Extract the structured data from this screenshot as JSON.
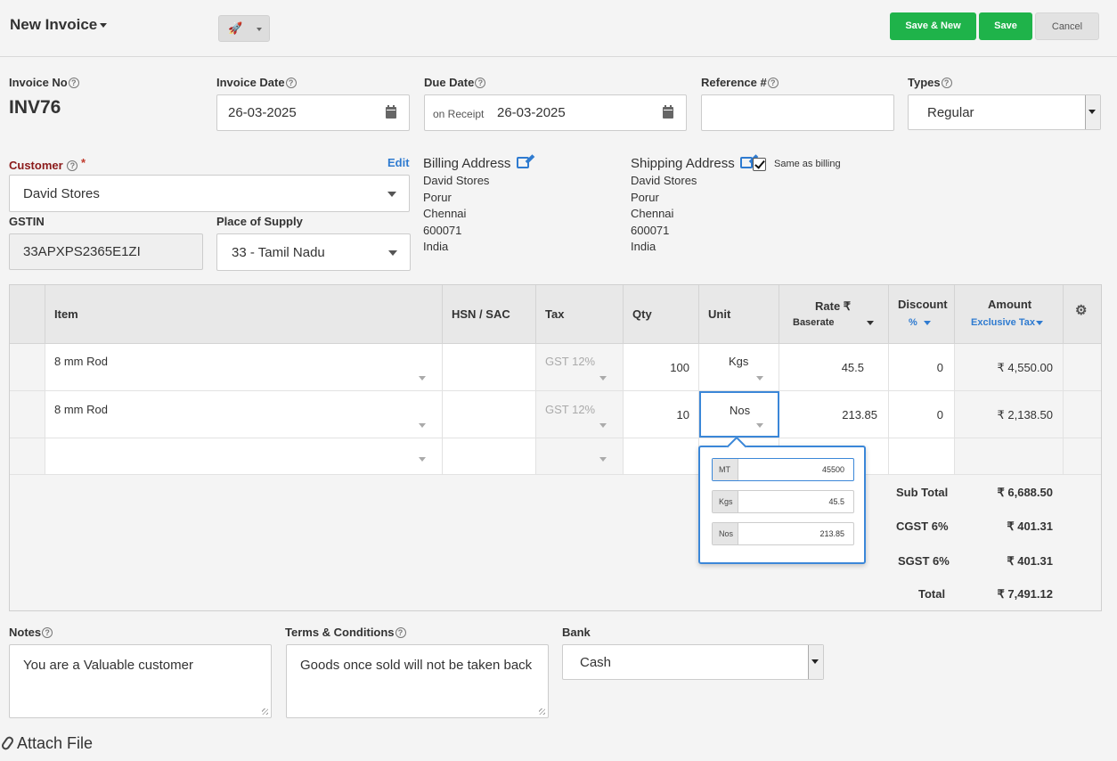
{
  "header": {
    "title": "New Invoice",
    "save_new_label": "Save & New",
    "save_label": "Save",
    "cancel_label": "Cancel"
  },
  "form": {
    "invoice_no_label": "Invoice No",
    "invoice_no": "INV76",
    "invoice_date_label": "Invoice Date",
    "invoice_date": "26-03-2025",
    "due_date_label": "Due Date",
    "due_date_prefix": "on Receipt",
    "due_date": "26-03-2025",
    "reference_label": "Reference #",
    "reference": "",
    "types_label": "Types",
    "types_value": "Regular",
    "customer_label": "Customer",
    "required_mark": "*",
    "edit_label": "Edit",
    "customer_value": "David Stores",
    "gstin_label": "GSTIN",
    "gstin_value": "33APXPS2365E1ZI",
    "place_label": "Place of Supply",
    "place_value": "33 - Tamil Nadu",
    "billing_title": "Billing Address",
    "billing_lines": [
      "David Stores",
      "Porur",
      "Chennai",
      "600071",
      "India"
    ],
    "shipping_title": "Shipping Address",
    "same_as_billing": "Same as billing",
    "shipping_lines": [
      "David Stores",
      "Porur",
      "Chennai",
      "600071",
      "India"
    ]
  },
  "table": {
    "headers": {
      "item": "Item",
      "hsn": "HSN / SAC",
      "tax": "Tax",
      "qty": "Qty",
      "unit": "Unit",
      "rate": "Rate ₹",
      "rate_sub": "Baserate",
      "discount": "Discount",
      "discount_sub": "%",
      "amount": "Amount",
      "amount_sub": "Exclusive Tax"
    },
    "rows": [
      {
        "item": "8 mm Rod",
        "tax": "GST 12%",
        "qty": "100",
        "unit": "Kgs",
        "rate": "45.5",
        "discount": "0",
        "amount": "₹ 4,550.00"
      },
      {
        "item": "8 mm Rod",
        "tax": "GST 12%",
        "qty": "10",
        "unit": "Nos",
        "rate": "213.85",
        "discount": "0",
        "amount": "₹ 2,138.50"
      }
    ],
    "totals": {
      "subtotal_label": "Sub Total",
      "subtotal": "₹ 6,688.50",
      "cgst_label": "CGST 6%",
      "cgst": "₹ 401.31",
      "sgst_label": "SGST 6%",
      "sgst": "₹ 401.31",
      "total_label": "Total",
      "total": "₹ 7,491.12"
    }
  },
  "unit_popup": {
    "rows": [
      {
        "unit": "MT",
        "value": "45500"
      },
      {
        "unit": "Kgs",
        "value": "45.5"
      },
      {
        "unit": "Nos",
        "value": "213.85"
      }
    ]
  },
  "footer": {
    "notes_label": "Notes",
    "notes_value": "You are a Valuable customer",
    "terms_label": "Terms & Conditions",
    "terms_value": "Goods once sold will not be taken back",
    "bank_label": "Bank",
    "bank_value": "Cash",
    "attach_label": "Attach File"
  },
  "colors": {
    "green": "#1fb34a",
    "accent_blue": "#2f7bd0",
    "customer_label": "#8b1a1a",
    "required": "#c0392b"
  },
  "icons": [
    "rocket-icon",
    "calendar-icon",
    "help-icon",
    "edit-icon",
    "gear-icon",
    "paperclip-icon",
    "checkbox-checked-icon"
  ]
}
